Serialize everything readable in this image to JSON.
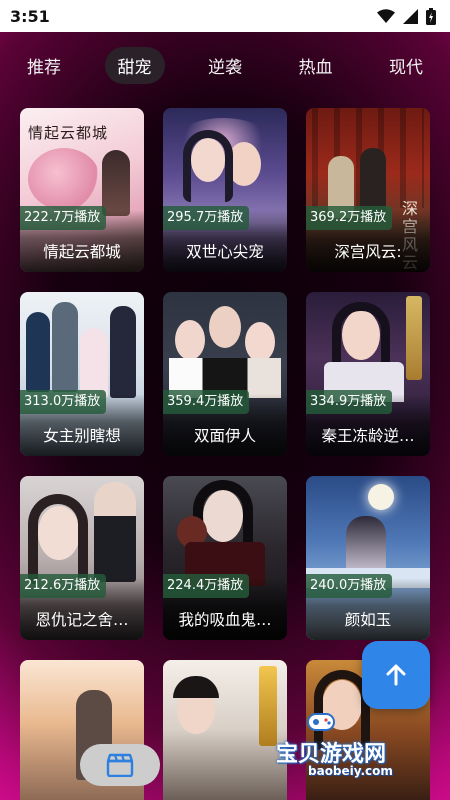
{
  "status_bar": {
    "time": "3:51"
  },
  "tabs": [
    {
      "label": "推荐",
      "active": false
    },
    {
      "label": "甜宠",
      "active": true
    },
    {
      "label": "逆袭",
      "active": false
    },
    {
      "label": "热血",
      "active": false
    },
    {
      "label": "现代",
      "active": false
    }
  ],
  "dramas": [
    {
      "title": "情起云都城",
      "plays": "222.7万播放",
      "poster_text": "情起云都城"
    },
    {
      "title": "双世心尖宠",
      "plays": "295.7万播放",
      "poster_text": ""
    },
    {
      "title": "深宫风云:",
      "plays": "369.2万播放",
      "poster_text": "深宫风云"
    },
    {
      "title": "女主别瞎想",
      "plays": "313.0万播放",
      "poster_text": ""
    },
    {
      "title": "双面伊人",
      "plays": "359.4万播放",
      "poster_text": ""
    },
    {
      "title": "秦王冻龄逆…",
      "plays": "334.9万播放",
      "poster_text": ""
    },
    {
      "title": "恩仇记之舍…",
      "plays": "212.6万播放",
      "poster_text": ""
    },
    {
      "title": "我的吸血鬼…",
      "plays": "224.4万播放",
      "poster_text": ""
    },
    {
      "title": "颜如玉",
      "plays": "240.0万播放",
      "poster_text": ""
    },
    {
      "title": "",
      "plays": "",
      "poster_text": ""
    },
    {
      "title": "",
      "plays": "",
      "poster_text": ""
    },
    {
      "title": "",
      "plays": "",
      "poster_text": ""
    }
  ],
  "watermark": {
    "name": "宝贝游戏网",
    "url": "baobeiy.com"
  },
  "icons": {
    "scroll_top": "arrow-up-icon",
    "bottom_nav": "clapperboard-icon",
    "wifi": "wifi-icon",
    "signal": "signal-icon",
    "battery": "battery-icon"
  },
  "colors": {
    "accent_magenta": "#d20c8e",
    "scroll_button": "#2f86e8",
    "plays_badge": "#245c3a",
    "active_tab": "#2a2129"
  }
}
